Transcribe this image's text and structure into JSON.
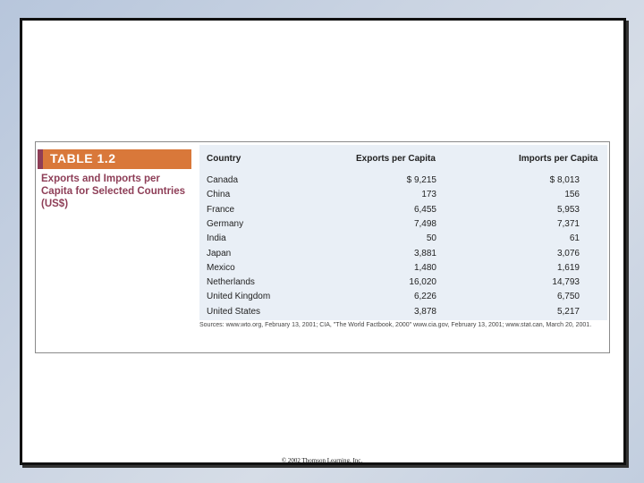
{
  "table": {
    "label": "TABLE 1.2",
    "caption": "Exports and Imports per Capita for Selected Countries (US$)",
    "headers": {
      "country": "Country",
      "exports": "Exports per Capita",
      "imports": "Imports per Capita"
    },
    "rows": [
      {
        "country": "Canada",
        "exports": "$ 9,215",
        "imports": "$ 8,013"
      },
      {
        "country": "China",
        "exports": "173",
        "imports": "156"
      },
      {
        "country": "France",
        "exports": "6,455",
        "imports": "5,953"
      },
      {
        "country": "Germany",
        "exports": "7,498",
        "imports": "7,371"
      },
      {
        "country": "India",
        "exports": "50",
        "imports": "61"
      },
      {
        "country": "Japan",
        "exports": "3,881",
        "imports": "3,076"
      },
      {
        "country": "Mexico",
        "exports": "1,480",
        "imports": "1,619"
      },
      {
        "country": "Netherlands",
        "exports": "16,020",
        "imports": "14,793"
      },
      {
        "country": "United Kingdom",
        "exports": "6,226",
        "imports": "6,750"
      },
      {
        "country": "United States",
        "exports": "3,878",
        "imports": "5,217"
      }
    ],
    "sources": "Sources: www.wto.org, February 13, 2001; CIA, \"The World Factbook, 2000\" www.cia.gov, February 13, 2001; www.stat.can, March 20, 2001."
  },
  "footer": {
    "copyright": "© 2002 Thomson Learning, Inc."
  },
  "colors": {
    "label_bar": "#d9783a",
    "caption_text": "#8e3e57",
    "table_bg": "#e9eff6"
  }
}
